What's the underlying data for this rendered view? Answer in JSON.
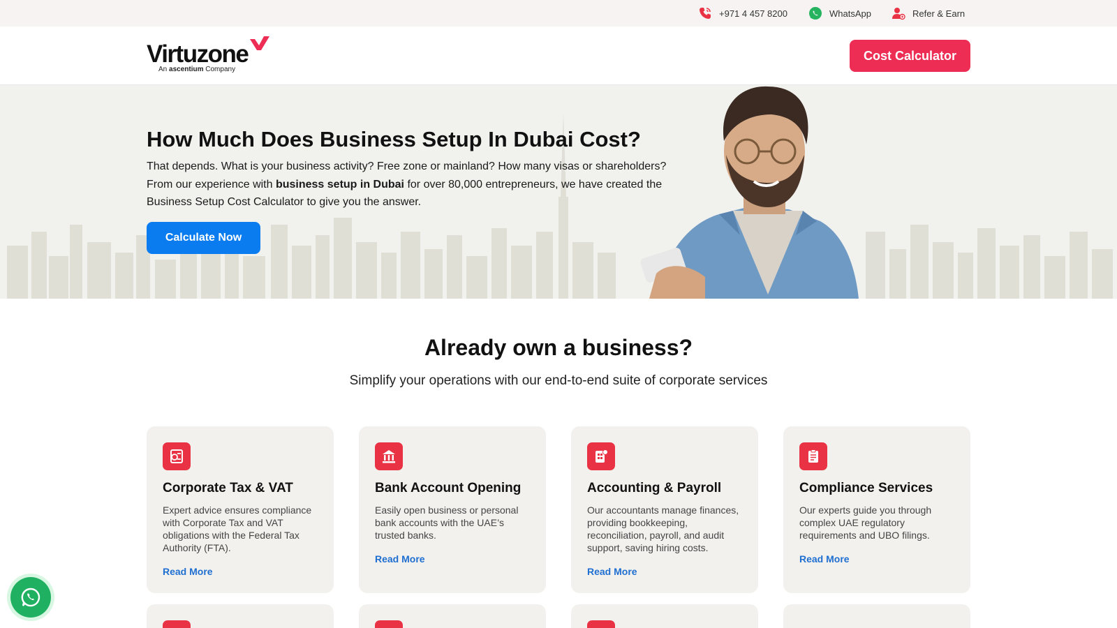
{
  "topbar": {
    "phone": "+971 4 457 8200",
    "whatsapp": "WhatsApp",
    "refer": "Refer & Earn",
    "icons": [
      "phone-icon",
      "whatsapp-icon",
      "refer-icon"
    ]
  },
  "header": {
    "logo_word": "Virtuzone",
    "logo_sub_prefix": "An",
    "logo_sub_brand": "ascentium",
    "logo_sub_suffix": "Company",
    "cost_button": "Cost Calculator"
  },
  "hero": {
    "title": "How Much Does Business Setup In Dubai Cost?",
    "text_part1": "That depends. What is your business activity? Free zone or mainland? How many visas or shareholders? From our experience with ",
    "text_bold": "business setup in Dubai",
    "text_part2": " for over 80,000 entrepreneurs, we have created the Business Setup Cost Calculator to give you the answer.",
    "cta": "Calculate Now"
  },
  "services": {
    "title": "Already own a business?",
    "subtitle": "Simplify your operations with our end-to-end suite of corporate services",
    "cards": [
      {
        "title": "Corporate Tax & VAT",
        "desc": "Expert advice ensures compliance with Corporate Tax and VAT obligations with the Federal Tax Authority (FTA).",
        "link": "Read More",
        "icon": "tax-icon"
      },
      {
        "title": "Bank Account Opening",
        "desc": "Easily open business or personal bank accounts with the UAE’s trusted banks.",
        "link": "Read More",
        "icon": "bank-icon"
      },
      {
        "title": "Accounting & Payroll",
        "desc": "Our accountants manage finances, providing bookkeeping, reconciliation, payroll, and audit support, saving hiring costs.",
        "link": "Read More",
        "icon": "accounting-icon"
      },
      {
        "title": "Compliance Services",
        "desc": "Our experts guide you through complex UAE regulatory requirements and UBO filings.",
        "link": "Read More",
        "icon": "clipboard-icon"
      }
    ]
  },
  "colors": {
    "brand_red": "#ee2d55",
    "cta_blue": "#0a7cf0",
    "link_blue": "#1f6fd1",
    "whatsapp_green": "#1fb062"
  }
}
